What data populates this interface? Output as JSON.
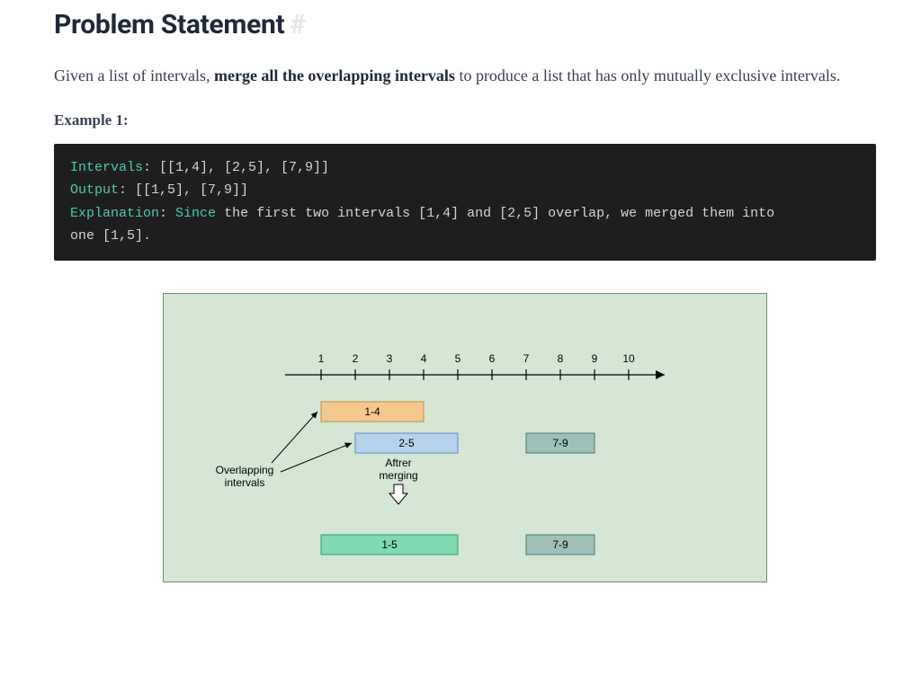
{
  "heading": {
    "title": "Problem Statement",
    "anchor": "#"
  },
  "description": {
    "prefix": "Given a list of intervals, ",
    "bold": "merge all the overlapping intervals",
    "suffix": " to produce a list that has only mutually exclusive intervals."
  },
  "example_label": "Example 1:",
  "code": {
    "line1": {
      "label": "Intervals",
      "value": "[[1,4], [2,5], [7,9]]"
    },
    "line2": {
      "label": "Output",
      "value": "[[1,5], [7,9]]"
    },
    "line3": {
      "label": "Explanation",
      "lead": "Since",
      "rest": "the first two intervals [1,4] and [2,5] overlap, we merged them into"
    },
    "line4": "one [1,5]."
  },
  "chart_data": {
    "type": "diagram",
    "axis": {
      "min": 1,
      "max": 10,
      "ticks": [
        1,
        2,
        3,
        4,
        5,
        6,
        7,
        8,
        9,
        10
      ]
    },
    "bars_before": [
      {
        "label": "1-4",
        "start": 1,
        "end": 4,
        "color": "#f5c98e",
        "border": "#c08a3e"
      },
      {
        "label": "2-5",
        "start": 2,
        "end": 5,
        "color": "#b7d2ec",
        "border": "#5a8fc6"
      },
      {
        "label": "7-9",
        "start": 7,
        "end": 9,
        "color": "#9fc0b9",
        "border": "#4c7a70"
      }
    ],
    "bars_after": [
      {
        "label": "1-5",
        "start": 1,
        "end": 5,
        "color": "#7fd9b1",
        "border": "#2f9e6d"
      },
      {
        "label": "7-9",
        "start": 7,
        "end": 9,
        "color": "#9fc0b9",
        "border": "#4c7a70"
      }
    ],
    "captions": {
      "overlapping": "Overlapping\nintervals",
      "after_merging": "Aftrer\nmerging"
    }
  }
}
